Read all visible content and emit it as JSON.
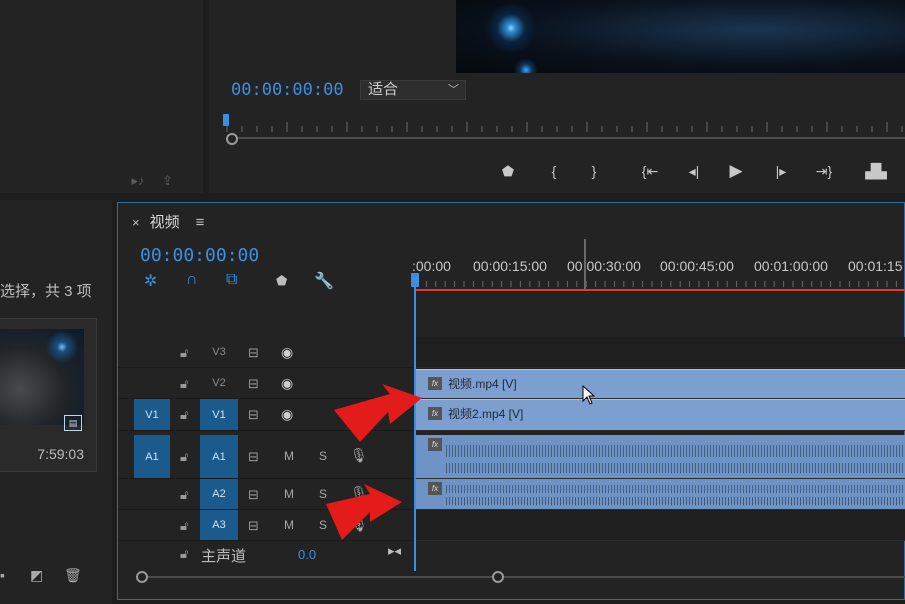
{
  "program_monitor": {
    "timecode": "00:00:00:00",
    "fit_value": "适合",
    "transport_icons": [
      "marker-icon",
      "mark-in-icon",
      "mark-out-icon",
      "go-to-in-icon",
      "step-back-icon",
      "play-icon",
      "step-forward-icon",
      "go-to-out-icon",
      "lift-icon"
    ]
  },
  "project_panel": {
    "selection_status": "选择，共 3 项",
    "clip_duration": "7:59:03"
  },
  "timeline": {
    "title": "视频",
    "timecode": "00:00:00:00",
    "ruler_labels": [
      ":00:00",
      "00:00:15:00",
      "00:00:30:00",
      "00:00:45:00",
      "00:01:00:00",
      "00:01:15"
    ],
    "tracks": {
      "v3": "V3",
      "v2": "V2",
      "v1_source": "V1",
      "v1_target": "V1",
      "a1_source": "A1",
      "a1_target": "A1",
      "a2": "A2",
      "a3": "A3",
      "mute": "M",
      "solo": "S"
    },
    "clips": {
      "v2": "视频.mp4 [V]",
      "v1": "视频2.mp4 [V]",
      "fx_badge": "fx"
    },
    "master": {
      "label": "主声道",
      "value": "0.0"
    }
  },
  "colors": {
    "accent_blue": "#3a8fe0",
    "video_clip": "#7c9fd0",
    "audio_clip": "#6e93c6",
    "playhead_red": "#e23a2a",
    "annotation_arrow": "#e41b1b"
  }
}
